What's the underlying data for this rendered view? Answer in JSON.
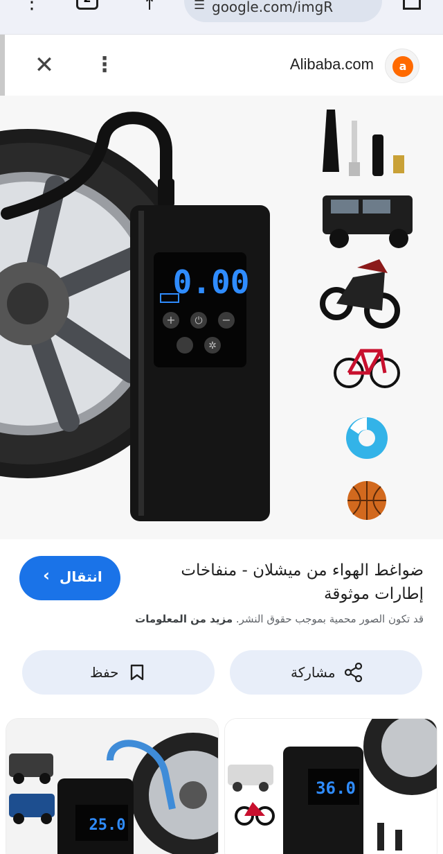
{
  "browser": {
    "url": "google.com/imgR",
    "tab_count": "2"
  },
  "viewer": {
    "source_name": "Alibaba.com"
  },
  "main_image": {
    "display_reading": "0.00"
  },
  "result": {
    "title": "ضواغط الهواء من ميشلان - منفاخات إطارات موثوقة",
    "goto_label": "انتقال",
    "notice": "قد تكون الصور محمية بموجب حقوق النشر.",
    "notice_link": "مزيد من المعلومات"
  },
  "actions": {
    "share_label": "مشاركة",
    "save_label": "حفظ"
  },
  "thumbnails": [
    {
      "display_reading": "25.0"
    },
    {
      "display_reading": "36.0"
    }
  ],
  "colors": {
    "accent": "#1a73e8",
    "action_bg": "#e8eef9",
    "display_blue": "#2f8cff",
    "brand_orange": "#ff6a00"
  }
}
